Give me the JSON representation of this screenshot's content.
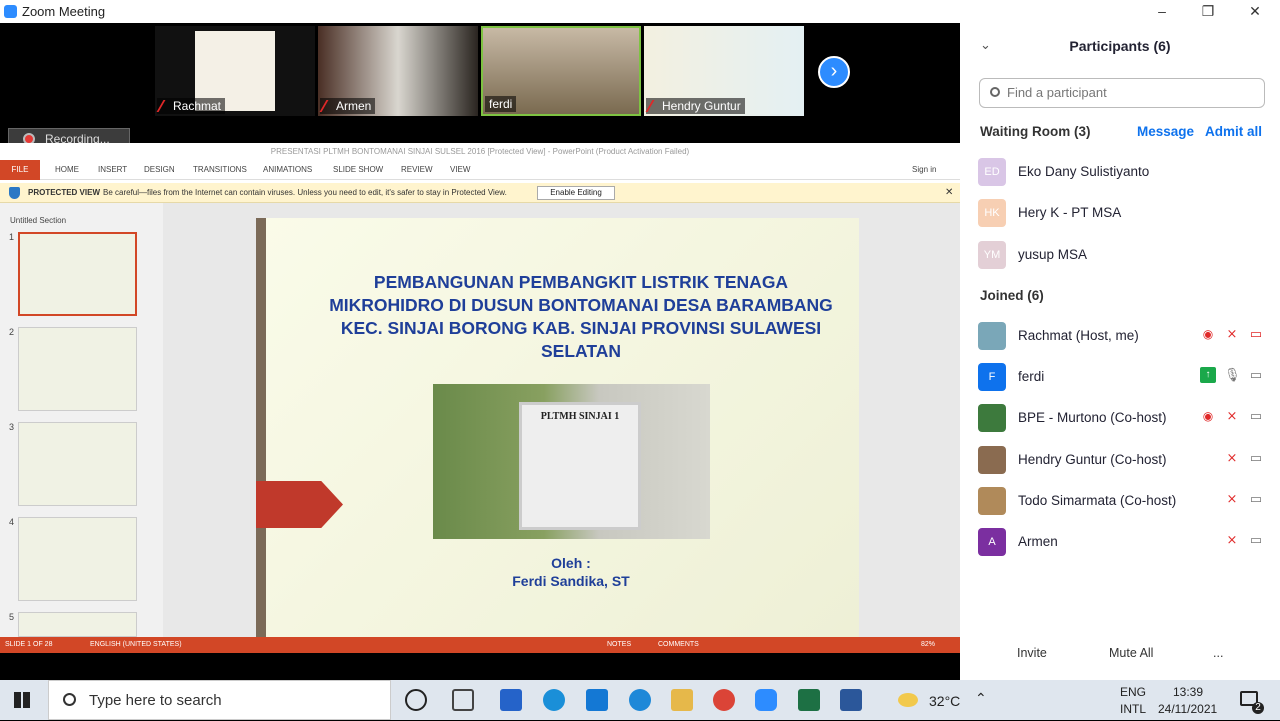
{
  "window": {
    "title": "Zoom Meeting"
  },
  "gallery": {
    "tiles": [
      {
        "name": "Rachmat"
      },
      {
        "name": "Armen"
      },
      {
        "name": "ferdi"
      },
      {
        "name": "Hendry Guntur"
      }
    ],
    "recording_label": "Recording..."
  },
  "ppt": {
    "window_title": "PRESENTASI  PLTMH BONTOMANAI SINJAI SULSEL 2016 [Protected View] - PowerPoint (Product Activation Failed)",
    "tabs": [
      "FILE",
      "HOME",
      "INSERT",
      "DESIGN",
      "TRANSITIONS",
      "ANIMATIONS",
      "SLIDE SHOW",
      "REVIEW",
      "VIEW"
    ],
    "sign_in": "Sign in",
    "protected_label": "PROTECTED VIEW",
    "protected_msg": "Be careful—files from the Internet can contain viruses. Unless you need to edit, it's safer to stay in Protected View.",
    "enable_editing": "Enable Editing",
    "section": "Untitled Section",
    "slide_numbers": [
      "1",
      "2",
      "3",
      "4",
      "5"
    ],
    "slide": {
      "title": "PEMBANGUNAN PEMBANGKIT LISTRIK TENAGA MIKROHIDRO DI DUSUN BONTOMANAI  DESA BARAMBANG KEC. SINJAI BORONG KAB. SINJAI PROVINSI SULAWESI SELATAN",
      "sign_text": "PLTMH SINJAI 1",
      "by": "Oleh :",
      "author": "Ferdi Sandika, ST"
    },
    "status": {
      "slide_count": "SLIDE 1 OF 28",
      "language": "ENGLISH (UNITED STATES)",
      "notes": "NOTES",
      "comments": "COMMENTS",
      "zoom": "82%"
    }
  },
  "participants": {
    "header": "Participants (6)",
    "search_placeholder": "Find a participant",
    "waiting_room": "Waiting Room (3)",
    "message": "Message",
    "admit_all": "Admit all",
    "waiting": [
      {
        "initials": "ED",
        "name": "Eko Dany Sulistiyanto",
        "color": "#d9c6e6"
      },
      {
        "initials": "HK",
        "name": "Hery K - PT MSA",
        "color": "#f7cfb3"
      },
      {
        "initials": "YM",
        "name": "yusup MSA",
        "color": "#e3cfd6"
      }
    ],
    "joined_label": "Joined (6)",
    "joined": [
      {
        "initials": "",
        "name": "Rachmat (Host, me)",
        "color": "#7aa7b8"
      },
      {
        "initials": "F",
        "name": "ferdi",
        "color": "#0e72ed"
      },
      {
        "initials": "",
        "name": "BPE - Murtono (Co-host)",
        "color": "#3d7a3d"
      },
      {
        "initials": "",
        "name": "Hendry Guntur (Co-host)",
        "color": "#8a6b50"
      },
      {
        "initials": "",
        "name": "Todo Simarmata (Co-host)",
        "color": "#b08a5a"
      },
      {
        "initials": "A",
        "name": "Armen",
        "color": "#7b2fa0"
      }
    ],
    "invite": "Invite",
    "mute_all": "Mute All",
    "more": "..."
  },
  "taskbar": {
    "search_placeholder": "Type here to search",
    "temperature": "32°C",
    "lang1": "ENG",
    "lang2": "INTL",
    "time": "13:39",
    "date": "24/11/2021",
    "notification_count": "2"
  }
}
